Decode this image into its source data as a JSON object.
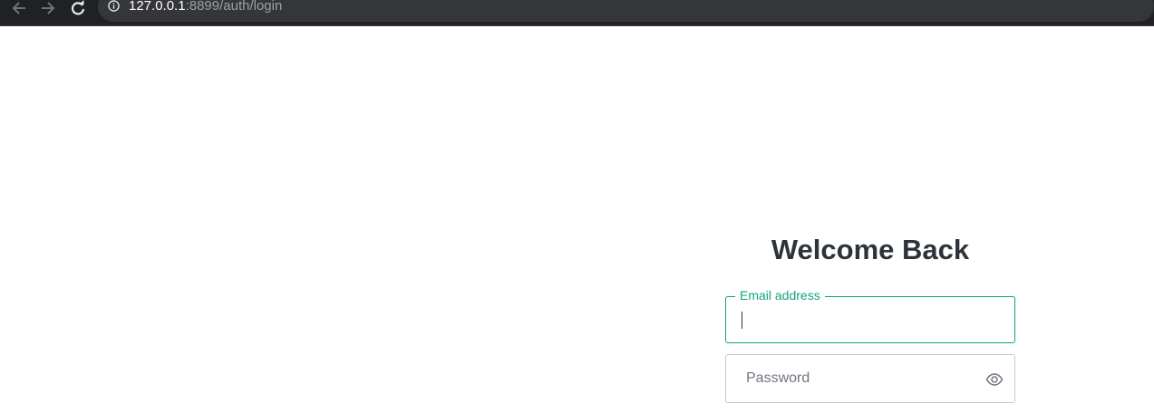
{
  "browser": {
    "url_host": "127.0.0.1",
    "url_rest": ":8899/auth/login",
    "icons": {
      "back": "arrow-left-icon",
      "forward": "arrow-right-icon",
      "reload": "reload-icon",
      "site_info": "info-icon"
    }
  },
  "login": {
    "title": "Welcome Back",
    "email": {
      "label": "Email address",
      "value": ""
    },
    "password": {
      "placeholder": "Password",
      "value": "",
      "toggle_icon": "eye-icon"
    }
  },
  "colors": {
    "accent": "#10a37f",
    "title_text": "#2d333a",
    "field_border": "#c2c8d0",
    "browser_bar": "#202124"
  }
}
